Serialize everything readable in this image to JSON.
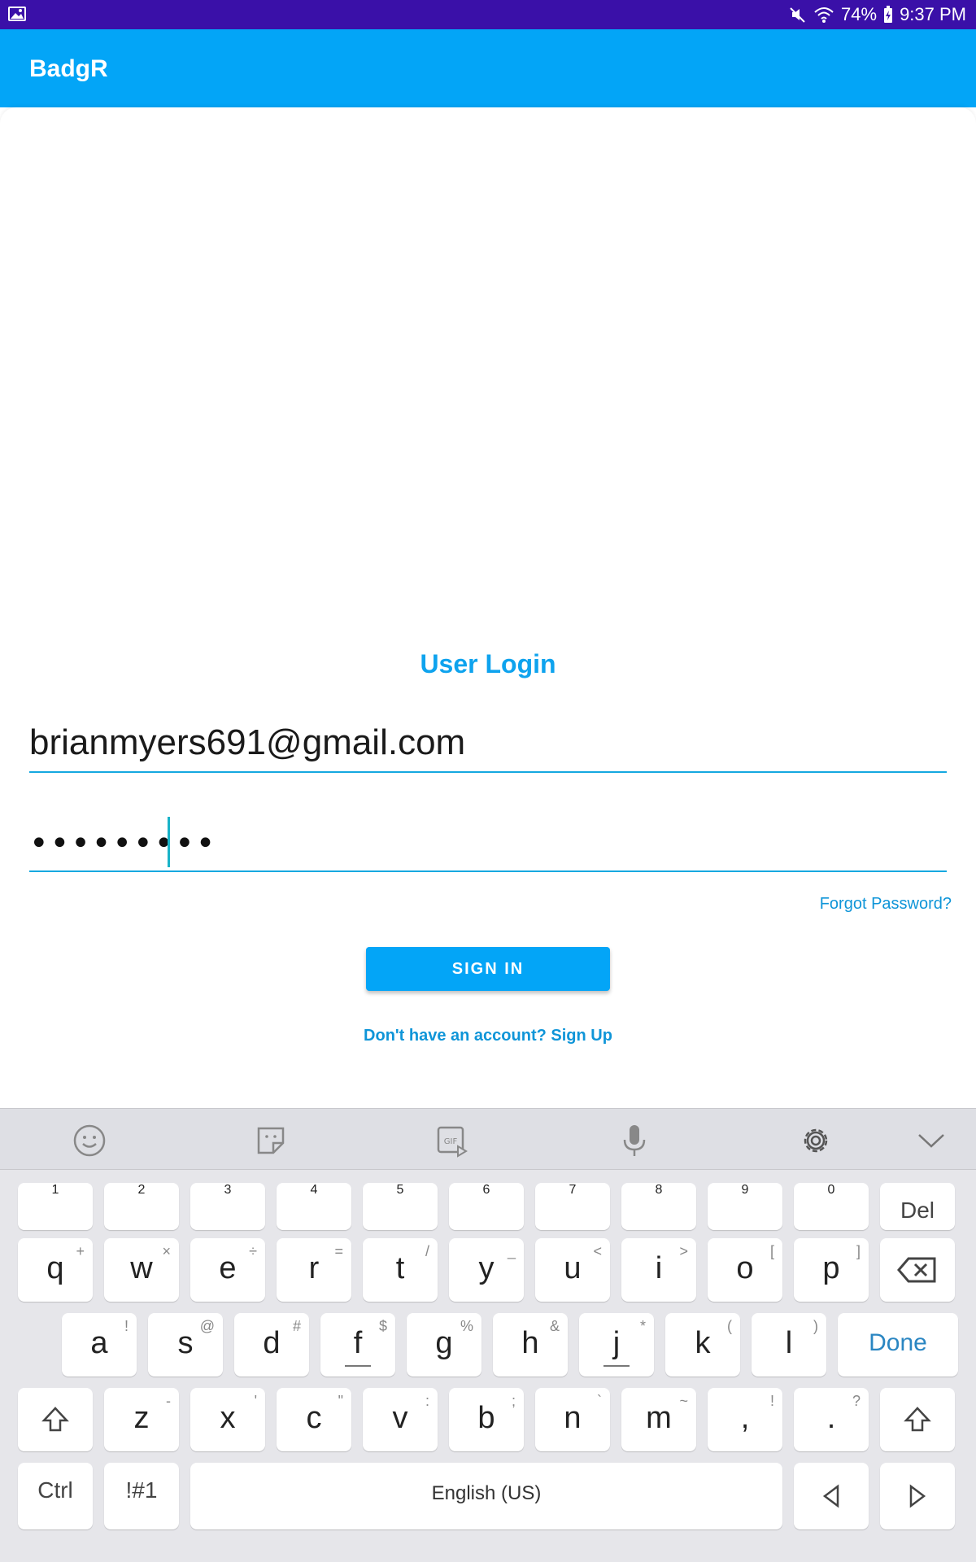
{
  "status_bar": {
    "battery": "74%",
    "time": "9:37 PM",
    "left_icon": "image-icon",
    "right_icons": [
      "mute-icon",
      "wifi-icon",
      "battery-icon"
    ]
  },
  "app_bar": {
    "title": "BadgR"
  },
  "login": {
    "title": "User Login",
    "email_value": "brianmyers691@gmail.com",
    "password_value": "•••••••••",
    "forgot_label": "Forgot Password?",
    "sign_in_label": "SIGN IN",
    "signup_label": "Don't have an account? Sign Up"
  },
  "keyboard": {
    "toolbar_icons": [
      "emoji-icon",
      "sticker-icon",
      "gif-icon",
      "microphone-icon",
      "settings-icon",
      "collapse-icon"
    ],
    "number_row": [
      "1",
      "2",
      "3",
      "4",
      "5",
      "6",
      "7",
      "8",
      "9",
      "0"
    ],
    "del_label": "Del",
    "row1": [
      {
        "k": "q",
        "a": "+"
      },
      {
        "k": "w",
        "a": "×"
      },
      {
        "k": "e",
        "a": "÷"
      },
      {
        "k": "r",
        "a": "="
      },
      {
        "k": "t",
        "a": "/"
      },
      {
        "k": "y",
        "a": "_"
      },
      {
        "k": "u",
        "a": "<"
      },
      {
        "k": "i",
        "a": ">"
      },
      {
        "k": "o",
        "a": "["
      },
      {
        "k": "p",
        "a": "]"
      }
    ],
    "row2": [
      {
        "k": "a",
        "a": "!"
      },
      {
        "k": "s",
        "a": "@"
      },
      {
        "k": "d",
        "a": "#"
      },
      {
        "k": "f",
        "a": "$"
      },
      {
        "k": "g",
        "a": "%"
      },
      {
        "k": "h",
        "a": "&"
      },
      {
        "k": "j",
        "a": "*"
      },
      {
        "k": "k",
        "a": "("
      },
      {
        "k": "l",
        "a": ")"
      }
    ],
    "done_label": "Done",
    "row3": [
      {
        "k": "z",
        "a": "-"
      },
      {
        "k": "x",
        "a": "'"
      },
      {
        "k": "c",
        "a": "\""
      },
      {
        "k": "v",
        "a": ":"
      },
      {
        "k": "b",
        "a": ";"
      },
      {
        "k": "n",
        "a": "`"
      },
      {
        "k": "m",
        "a": "~"
      },
      {
        "k": ",",
        "a": "!"
      },
      {
        "k": ".",
        "a": "?"
      }
    ],
    "ctrl_label": "Ctrl",
    "symbols_label": "!#1",
    "space_label": "English (US)",
    "colors": {
      "key": "#ffffff",
      "keyboard_bg": "#e6e6ea",
      "done": "#2a86c2"
    }
  },
  "colors": {
    "status_bar": "#3a10a8",
    "app_bar": "#03a5f7",
    "accent": "#0ea3ee"
  }
}
